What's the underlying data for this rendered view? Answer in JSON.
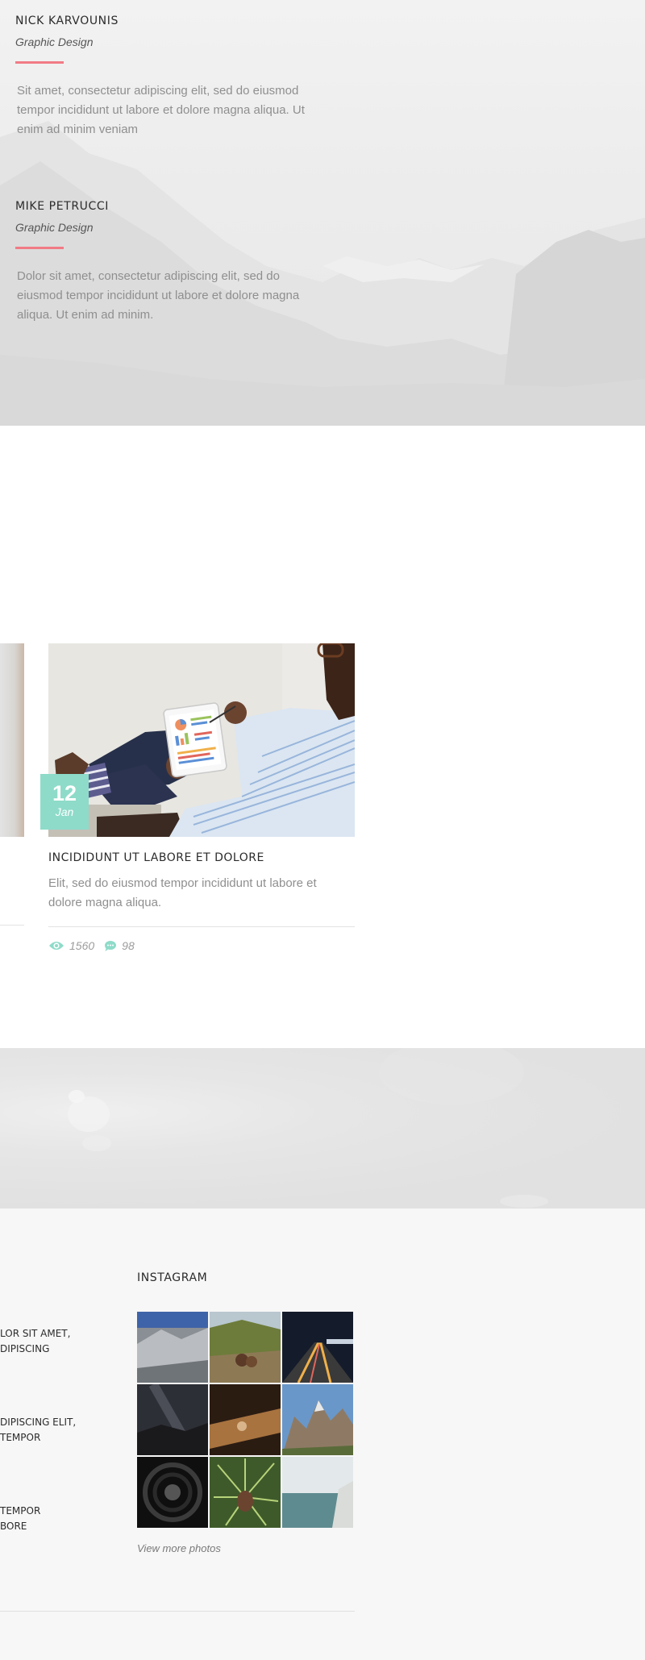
{
  "team": {
    "members": [
      {
        "name": "NICK KARVOUNIS",
        "role": "Graphic Design",
        "description": "Sit amet, consectetur adipiscing elit, sed do eiusmod tempor incididunt ut labore et dolore magna aliqua. Ut enim ad minim veniam"
      },
      {
        "name": "MIKE PETRUCCI",
        "role": "Graphic Design",
        "description": "Dolor sit amet, consectetur adipiscing elit, sed do eiusmod tempor incididunt ut labore et dolore magna aliqua. Ut enim ad minim."
      }
    ],
    "accent_color": "#f17b85"
  },
  "blog": {
    "post": {
      "date_day": "12",
      "date_month": "Jan",
      "title": "INCIDIDUNT UT LABORE ET DOLORE",
      "excerpt": "Elit, sed do eiusmod tempor incididunt ut labore et dolore magna aliqua.",
      "views": "1560",
      "comments": "98",
      "views_icon": "eye-icon",
      "comments_icon": "speech-bubble-icon"
    },
    "badge_color": "#8edbc9"
  },
  "footer": {
    "recent_posts": [
      {
        "line1": "LOR SIT AMET,",
        "line2": "DIPISCING"
      },
      {
        "line1": "DIPISCING ELIT,",
        "line2": "TEMPOR"
      },
      {
        "line1": "TEMPOR",
        "line2": "BORE"
      }
    ],
    "instagram": {
      "title": "INSTAGRAM",
      "more_link": "View more photos"
    }
  }
}
